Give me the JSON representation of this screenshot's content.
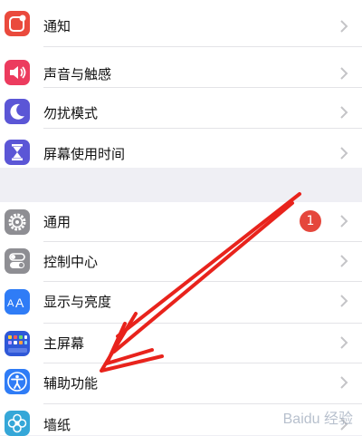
{
  "settings_group_1": {
    "items": [
      {
        "label": "通知",
        "icon": "notifications-icon",
        "icon_color": "#ea4a3d"
      },
      {
        "label": "声音与触感",
        "icon": "sound-icon",
        "icon_color": "#ec3b5e"
      },
      {
        "label": "勿扰模式",
        "icon": "moon-icon",
        "icon_color": "#5b56d6"
      },
      {
        "label": "屏幕使用时间",
        "icon": "hourglass-icon",
        "icon_color": "#5b56d6"
      }
    ]
  },
  "settings_group_2": {
    "items": [
      {
        "label": "通用",
        "icon": "gear-icon",
        "icon_color": "#8e8e93",
        "badge": "1"
      },
      {
        "label": "控制中心",
        "icon": "toggles-icon",
        "icon_color": "#8e8e93"
      },
      {
        "label": "显示与亮度",
        "icon": "text-size-icon",
        "icon_color": "#2f7cf6"
      },
      {
        "label": "主屏幕",
        "icon": "home-screen-icon",
        "icon_color": "#2f58d8"
      },
      {
        "label": "辅助功能",
        "icon": "accessibility-icon",
        "icon_color": "#2f7cf6"
      },
      {
        "label": "墙纸",
        "icon": "wallpaper-icon",
        "icon_color": "#35a7d8"
      }
    ]
  },
  "annotation": {
    "arrow_color": "#e8231c"
  },
  "watermark": {
    "text": "Baidu 经验"
  }
}
